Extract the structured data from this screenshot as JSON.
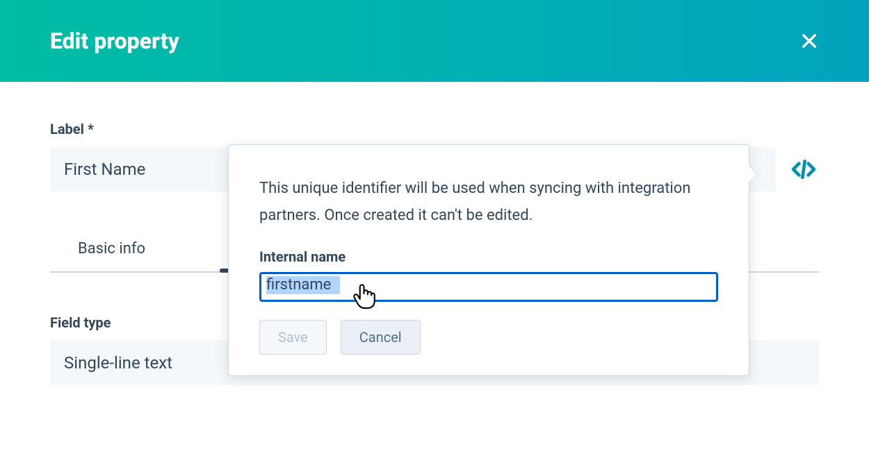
{
  "header": {
    "title": "Edit property"
  },
  "form": {
    "label_field_label": "Label *",
    "label_value": "First Name",
    "tabs": {
      "basic_info": "Basic info"
    },
    "field_type_label": "Field type",
    "field_type_value": "Single-line text"
  },
  "popover": {
    "description": "This unique identifier will be used when syncing with integration partners. Once created it can't be edited.",
    "internal_name_label": "Internal name",
    "internal_name_value": "firstname",
    "save_label": "Save",
    "cancel_label": "Cancel"
  }
}
